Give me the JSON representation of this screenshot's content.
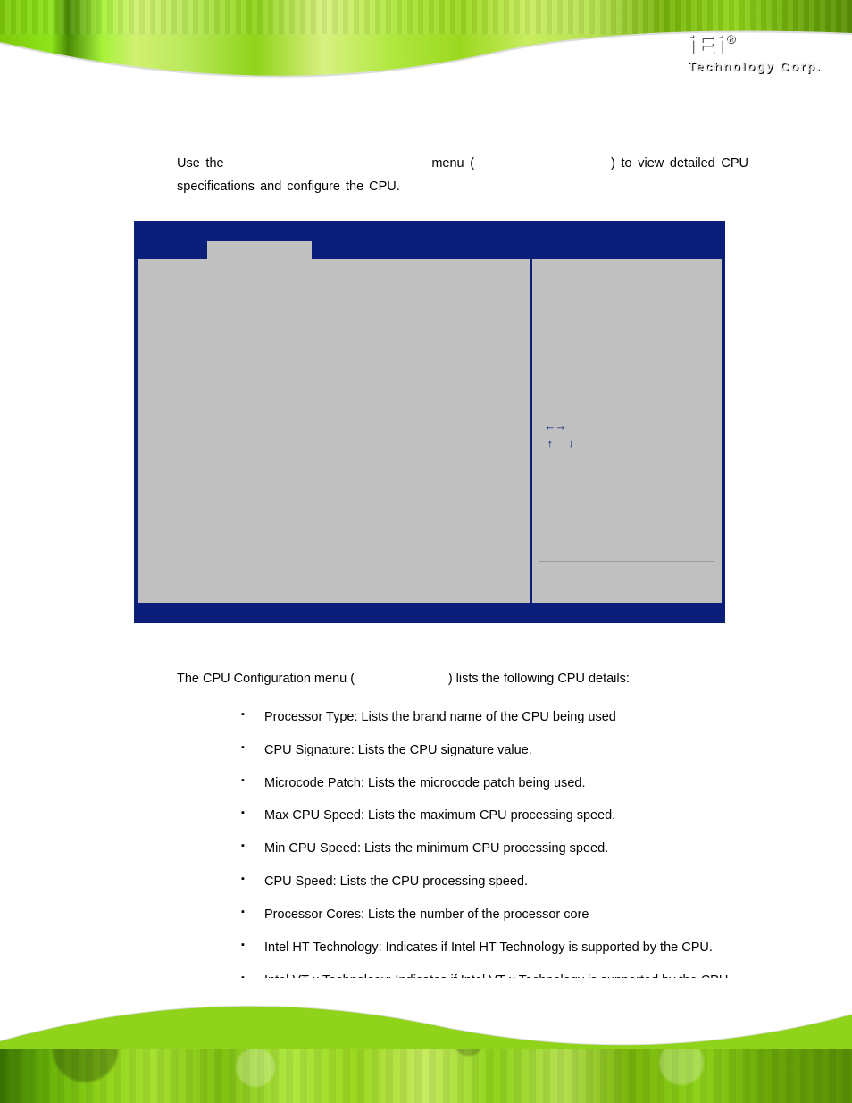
{
  "brand": {
    "name": "iEi",
    "registered": "®",
    "tagline": "Technology Corp."
  },
  "intro": {
    "prefix": "Use the",
    "mid": "menu (",
    "suffix": ") to view detailed CPU specifications and configure the CPU."
  },
  "bios_nav_arrows": {
    "row1": "←→",
    "row2": "↑ ↓"
  },
  "lower": {
    "lead_prefix": "The CPU Configuration menu (",
    "lead_suffix": ") lists the following CPU details:",
    "items": [
      "Processor Type: Lists the brand name of the CPU being used",
      "CPU Signature: Lists the CPU signature value.",
      "Microcode Patch: Lists the microcode patch being used.",
      "Max CPU Speed: Lists the maximum CPU processing speed.",
      "Min CPU Speed: Lists the minimum CPU processing speed.",
      "CPU Speed: Lists the CPU processing speed.",
      "Processor Cores: Lists the number of the processor core",
      "Intel HT Technology: Indicates if Intel HT Technology is supported by the CPU.",
      "Intel VT-x Technology: Indicates if Intel VT-x Technology is supported by the CPU."
    ]
  }
}
